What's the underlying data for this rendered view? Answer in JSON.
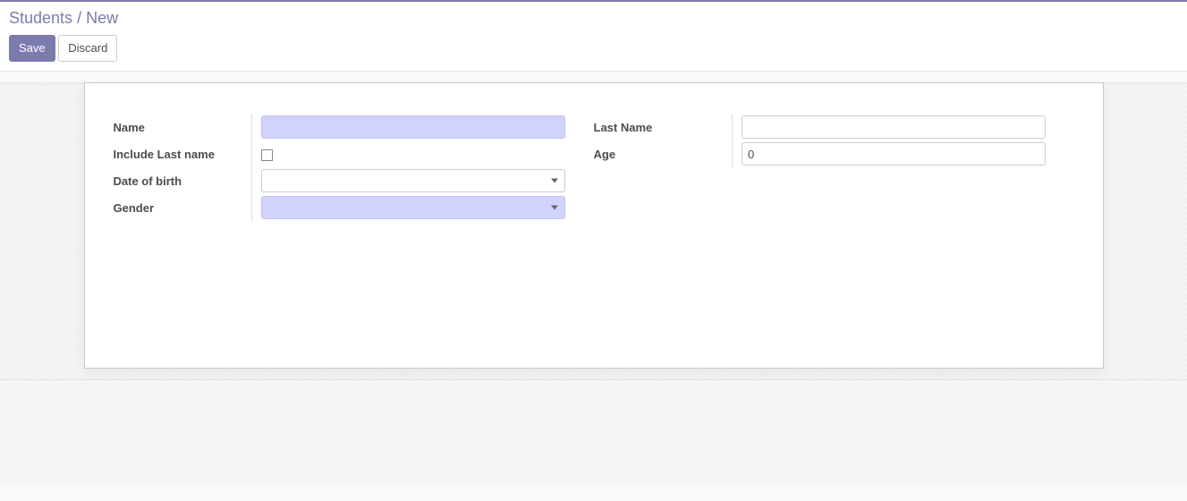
{
  "breadcrumb": {
    "parent": "Students",
    "sep": "/",
    "current": "New"
  },
  "toolbar": {
    "save_label": "Save",
    "discard_label": "Discard"
  },
  "form": {
    "left": {
      "name_label": "Name",
      "name_value": "",
      "include_last_label": "Include Last name",
      "include_last_checked": false,
      "dob_label": "Date of birth",
      "dob_value": "",
      "gender_label": "Gender",
      "gender_value": ""
    },
    "right": {
      "last_name_label": "Last Name",
      "last_name_value": "",
      "age_label": "Age",
      "age_value": "0"
    }
  }
}
